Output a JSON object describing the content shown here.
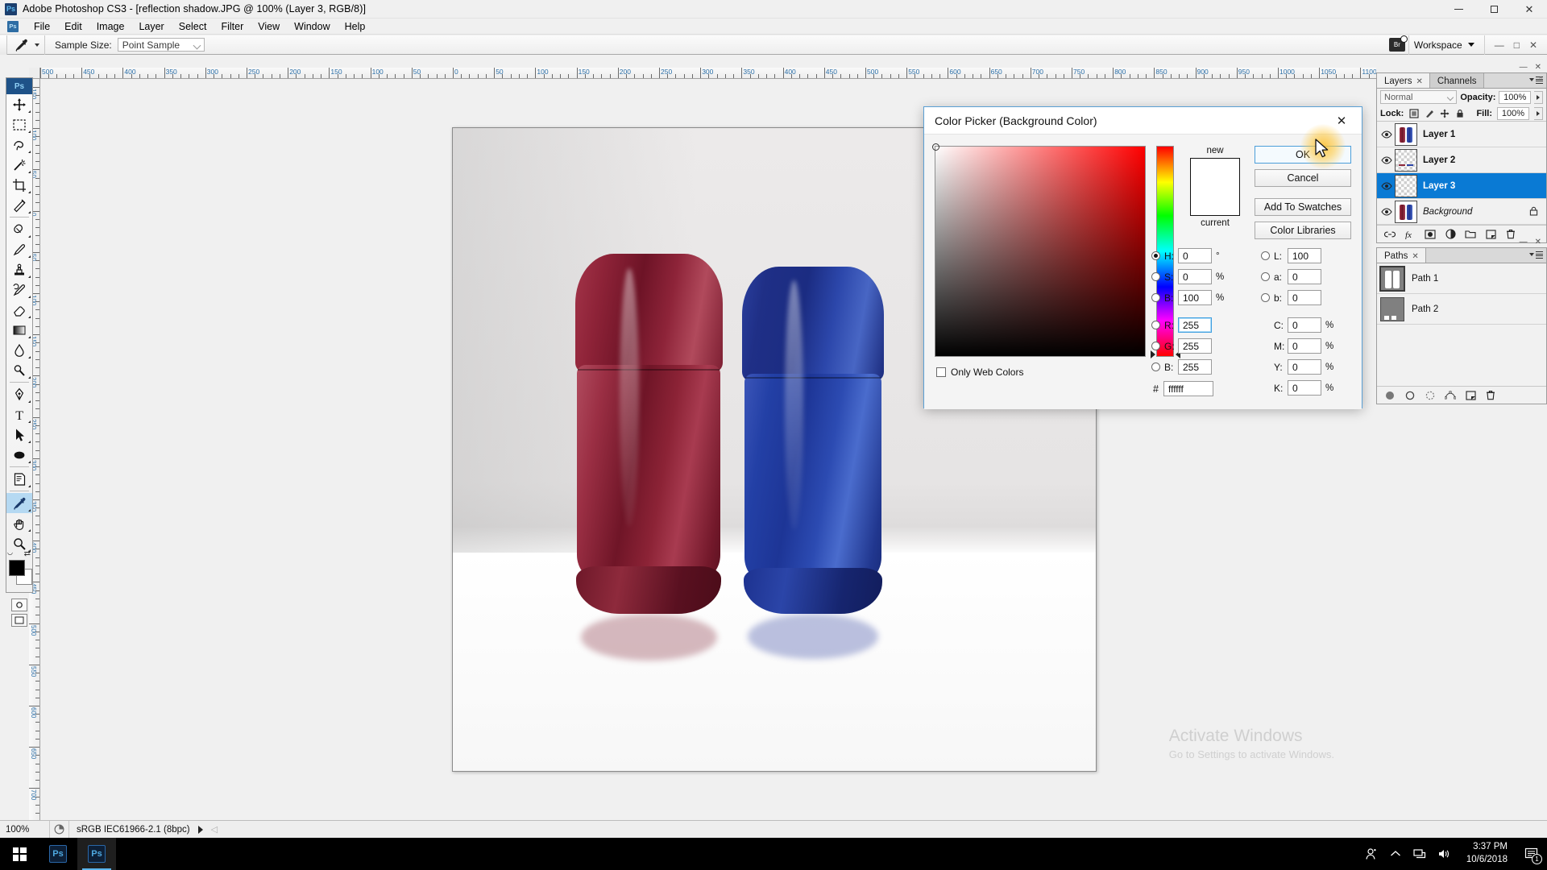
{
  "window": {
    "title": "Adobe Photoshop CS3 - [reflection shadow.JPG @ 100% (Layer 3, RGB/8)]",
    "app_badge": "Ps"
  },
  "menu": {
    "items": [
      "File",
      "Edit",
      "Image",
      "Layer",
      "Select",
      "Filter",
      "View",
      "Window",
      "Help"
    ]
  },
  "options_bar": {
    "tool_icon": "eyedropper-icon",
    "sample_size_label": "Sample Size:",
    "sample_size_value": "Point Sample",
    "bridge_icon": "bridge-icon",
    "workspace_label": "Workspace"
  },
  "rulers": {
    "horizontal_labels": [
      "500",
      "450",
      "400",
      "350",
      "300",
      "250",
      "200",
      "150",
      "100",
      "50",
      "0",
      "50",
      "100",
      "150",
      "200",
      "250",
      "300",
      "350",
      "400",
      "450",
      "500",
      "550",
      "600",
      "650",
      "700",
      "750",
      "800",
      "850",
      "900",
      "950",
      "1000",
      "1050",
      "1100"
    ],
    "vertical_labels": [
      "150",
      "100",
      "50",
      "0",
      "50",
      "100",
      "150",
      "200",
      "250",
      "300",
      "350",
      "400",
      "450",
      "500",
      "550",
      "600",
      "650",
      "700"
    ]
  },
  "toolbox": {
    "tools": [
      {
        "name": "move-tool",
        "glyph": "move"
      },
      {
        "name": "marquee-tool",
        "glyph": "marquee"
      },
      {
        "name": "lasso-tool",
        "glyph": "lasso"
      },
      {
        "name": "magic-wand-tool",
        "glyph": "wand"
      },
      {
        "name": "crop-tool",
        "glyph": "crop"
      },
      {
        "name": "slice-tool",
        "glyph": "slice"
      },
      {
        "name": "healing-brush-tool",
        "glyph": "heal"
      },
      {
        "name": "brush-tool",
        "glyph": "brush"
      },
      {
        "name": "clone-stamp-tool",
        "glyph": "stamp"
      },
      {
        "name": "history-brush-tool",
        "glyph": "historybrush"
      },
      {
        "name": "eraser-tool",
        "glyph": "eraser"
      },
      {
        "name": "gradient-tool",
        "glyph": "gradient"
      },
      {
        "name": "blur-tool",
        "glyph": "blur"
      },
      {
        "name": "dodge-tool",
        "glyph": "dodge"
      },
      {
        "name": "pen-tool",
        "glyph": "pen"
      },
      {
        "name": "type-tool",
        "glyph": "type"
      },
      {
        "name": "path-selection-tool",
        "glyph": "pathsel"
      },
      {
        "name": "ellipse-shape-tool",
        "glyph": "ellipse"
      },
      {
        "name": "notes-tool",
        "glyph": "notes"
      },
      {
        "name": "eyedropper-tool",
        "glyph": "eyedropper"
      },
      {
        "name": "hand-tool",
        "glyph": "hand"
      },
      {
        "name": "zoom-tool",
        "glyph": "zoom"
      }
    ],
    "active_tool": "eyedropper-tool",
    "foreground_color": "#000000",
    "background_color": "#ffffff"
  },
  "color_picker": {
    "title": "Color Picker (Background Color)",
    "new_label": "new",
    "current_label": "current",
    "new_swatch": "#ffffff",
    "current_swatch": "#ffffff",
    "buttons": {
      "ok": "OK",
      "cancel": "Cancel",
      "add_to_swatches": "Add To Swatches",
      "color_libraries": "Color Libraries"
    },
    "only_web_colors_label": "Only Web Colors",
    "only_web_colors_checked": false,
    "selected_radio": "H",
    "fields": {
      "H": {
        "label": "H:",
        "value": "0",
        "unit": "°"
      },
      "S": {
        "label": "S:",
        "value": "0",
        "unit": "%"
      },
      "B": {
        "label": "B:",
        "value": "100",
        "unit": "%"
      },
      "R": {
        "label": "R:",
        "value": "255",
        "unit": ""
      },
      "G": {
        "label": "G:",
        "value": "255",
        "unit": ""
      },
      "Bb": {
        "label": "B:",
        "value": "255",
        "unit": ""
      },
      "L": {
        "label": "L:",
        "value": "100",
        "unit": ""
      },
      "a": {
        "label": "a:",
        "value": "0",
        "unit": ""
      },
      "b": {
        "label": "b:",
        "value": "0",
        "unit": ""
      },
      "C": {
        "label": "C:",
        "value": "0",
        "unit": "%"
      },
      "M": {
        "label": "M:",
        "value": "0",
        "unit": "%"
      },
      "Y": {
        "label": "Y:",
        "value": "0",
        "unit": "%"
      },
      "K": {
        "label": "K:",
        "value": "0",
        "unit": "%"
      }
    },
    "hex_label": "#",
    "hex_value": "ffffff"
  },
  "layers_panel": {
    "tabs": [
      {
        "label": "Layers",
        "active": true
      },
      {
        "label": "Channels",
        "active": false
      }
    ],
    "blend_mode": "Normal",
    "opacity_label": "Opacity:",
    "opacity_value": "100%",
    "lock_label": "Lock:",
    "fill_label": "Fill:",
    "fill_value": "100%",
    "lock_icons": [
      "lock-transparent-icon",
      "lock-image-icon",
      "lock-position-icon",
      "lock-all-icon"
    ],
    "layers": [
      {
        "name": "Layer 1",
        "thumb": "bottles",
        "visible": true,
        "selected": false,
        "locked": false,
        "italic": false
      },
      {
        "name": "Layer 2",
        "thumb": "transparent-strokes",
        "visible": true,
        "selected": false,
        "locked": false,
        "italic": false
      },
      {
        "name": "Layer 3",
        "thumb": "transparent",
        "visible": true,
        "selected": true,
        "locked": false,
        "italic": false
      },
      {
        "name": "Background",
        "thumb": "bottles",
        "visible": true,
        "selected": false,
        "locked": true,
        "italic": true
      }
    ],
    "footer_icons": [
      "link-layers-icon",
      "layer-style-icon",
      "layer-mask-icon",
      "adjustment-layer-icon",
      "new-group-icon",
      "new-layer-icon",
      "delete-layer-icon"
    ]
  },
  "paths_panel": {
    "tabs": [
      {
        "label": "Paths",
        "active": true
      }
    ],
    "paths": [
      {
        "name": "Path 1",
        "thumb": "bottles-outline",
        "selected": true
      },
      {
        "name": "Path 2",
        "thumb": "filled-gray"
      }
    ],
    "footer_icons": [
      "fill-path-icon",
      "stroke-path-icon",
      "load-selection-icon",
      "make-work-path-icon",
      "new-path-icon",
      "delete-path-icon"
    ]
  },
  "status_bar": {
    "zoom": "100%",
    "profile_icon": "color-profile-icon",
    "document_profile": "sRGB IEC61966-2.1 (8bpc)"
  },
  "watermark": {
    "line1": "Activate Windows",
    "line2": "Go to Settings to activate Windows."
  },
  "taskbar": {
    "start_icon": "windows-start-icon",
    "apps": [
      {
        "name": "photoshop-taskbar-item-1",
        "label": "Ps",
        "active": false
      },
      {
        "name": "photoshop-taskbar-item-2",
        "label": "Ps",
        "active": true
      }
    ],
    "tray_icons": [
      "people-icon",
      "show-hidden-icons-icon",
      "network-icon",
      "volume-icon"
    ],
    "time": "3:37 PM",
    "date": "10/6/2018",
    "notification_count": "1"
  },
  "colors": {
    "selection_blue": "#0a7ad4",
    "dialog_border": "#5a9fd4",
    "highlight_ring": "#ffbe28"
  }
}
